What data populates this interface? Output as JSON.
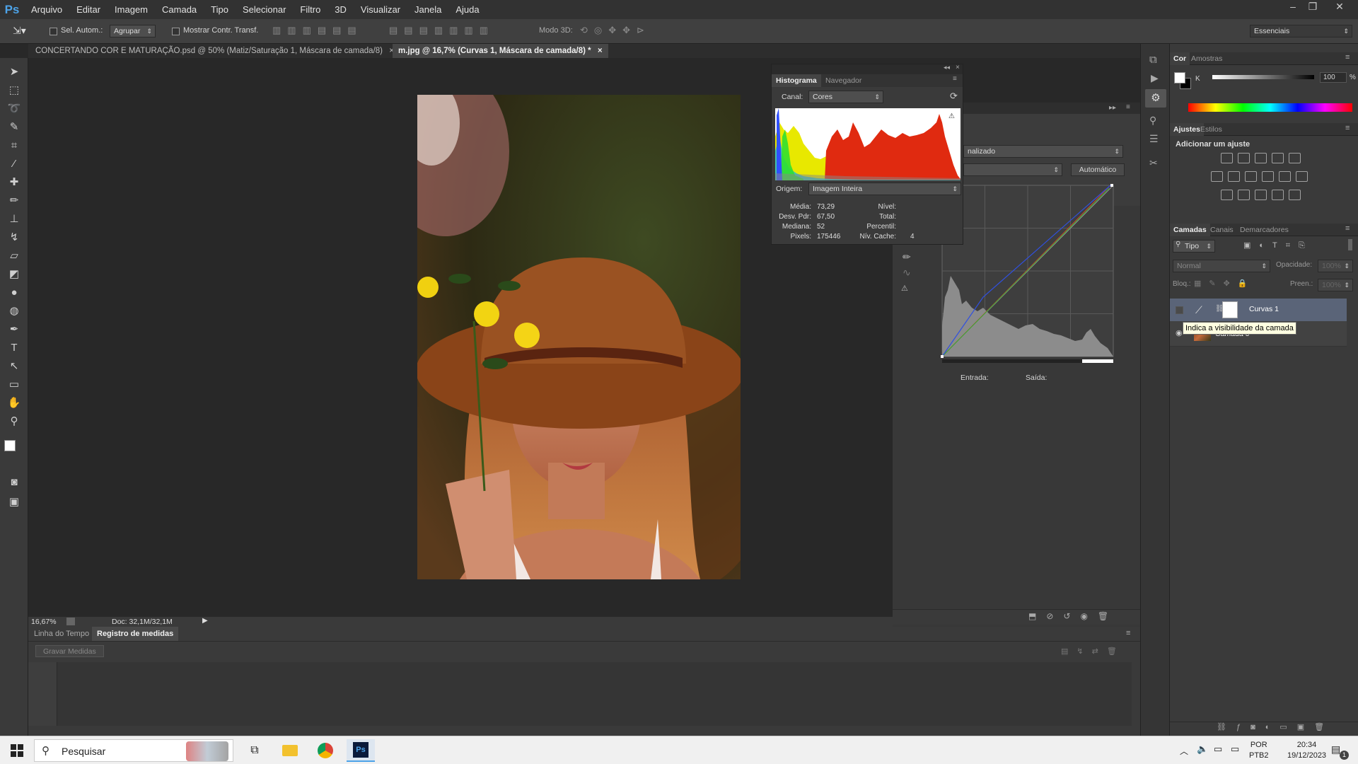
{
  "app": {
    "logo": "Ps"
  },
  "menu": [
    "Arquivo",
    "Editar",
    "Imagem",
    "Camada",
    "Tipo",
    "Selecionar",
    "Filtro",
    "3D",
    "Visualizar",
    "Janela",
    "Ajuda"
  ],
  "options": {
    "auto_select_label": "Sel. Autom.:",
    "auto_select_value": "Agrupar",
    "show_transform_label": "Mostrar Contr. Transf.",
    "mode3d_label": "Modo 3D:",
    "workspace": "Essenciais"
  },
  "doc_tabs": [
    {
      "label": "CONCERTANDO  COR E MATURAÇÃO.psd @ 50% (Matiz/Saturação 1, Máscara de camada/8)",
      "close": "×"
    },
    {
      "label": "m.jpg @ 16,7% (Curvas 1, Máscara de camada/8) *",
      "close": "×"
    }
  ],
  "status": {
    "zoom": "16,67%",
    "doc": "Doc: 32,1M/32,1M"
  },
  "bottom_panel": {
    "tabs": [
      "Linha do Tempo",
      "Registro de medidas"
    ],
    "record_button": "Gravar Medidas"
  },
  "histogram": {
    "tabs": [
      "Histograma",
      "Navegador"
    ],
    "channel_label": "Canal:",
    "channel_value": "Cores",
    "source_label": "Origem:",
    "source_value": "Imagem Inteira",
    "stats_left": [
      {
        "label": "Média:",
        "value": "73,29"
      },
      {
        "label": "Desv. Pdr:",
        "value": "67,50"
      },
      {
        "label": "Mediana:",
        "value": "52"
      },
      {
        "label": "Pixels:",
        "value": "175446"
      }
    ],
    "stats_right": [
      {
        "label": "Nível:",
        "value": ""
      },
      {
        "label": "Total:",
        "value": ""
      },
      {
        "label": "Percentil:",
        "value": ""
      },
      {
        "label": "Nív. Cache:",
        "value": "4"
      }
    ]
  },
  "properties": {
    "preset_value": "nalizado",
    "auto_button": "Automático",
    "input_label": "Entrada:",
    "output_label": "Saída:"
  },
  "color_panel": {
    "tabs": [
      "Cor",
      "Amostras"
    ],
    "channel": "K",
    "value": "100",
    "unit": "%"
  },
  "adjustments": {
    "tabs": [
      "Ajustes",
      "Estilos"
    ],
    "title": "Adicionar um ajuste"
  },
  "layers": {
    "tabs": [
      "Camadas",
      "Canais",
      "Demarcadores"
    ],
    "filter": "Tipo",
    "blend_mode": "Normal",
    "opacity_label": "Opacidade:",
    "opacity_value": "100%",
    "lock_label": "Bloq.:",
    "fill_label": "Preen.:",
    "fill_value": "100%",
    "items": [
      {
        "name": "Curvas 1"
      },
      {
        "name": "Camada 0"
      }
    ],
    "tooltip": "Indica a visibilidade da camada"
  },
  "taskbar": {
    "search_placeholder": "Pesquisar",
    "lang1": "POR",
    "lang2": "PTB2",
    "time": "20:34",
    "date": "19/12/2023",
    "notif_count": "1"
  },
  "colors": {
    "bg": "#282828",
    "panel": "#424242",
    "accent": "#4da3e8"
  }
}
